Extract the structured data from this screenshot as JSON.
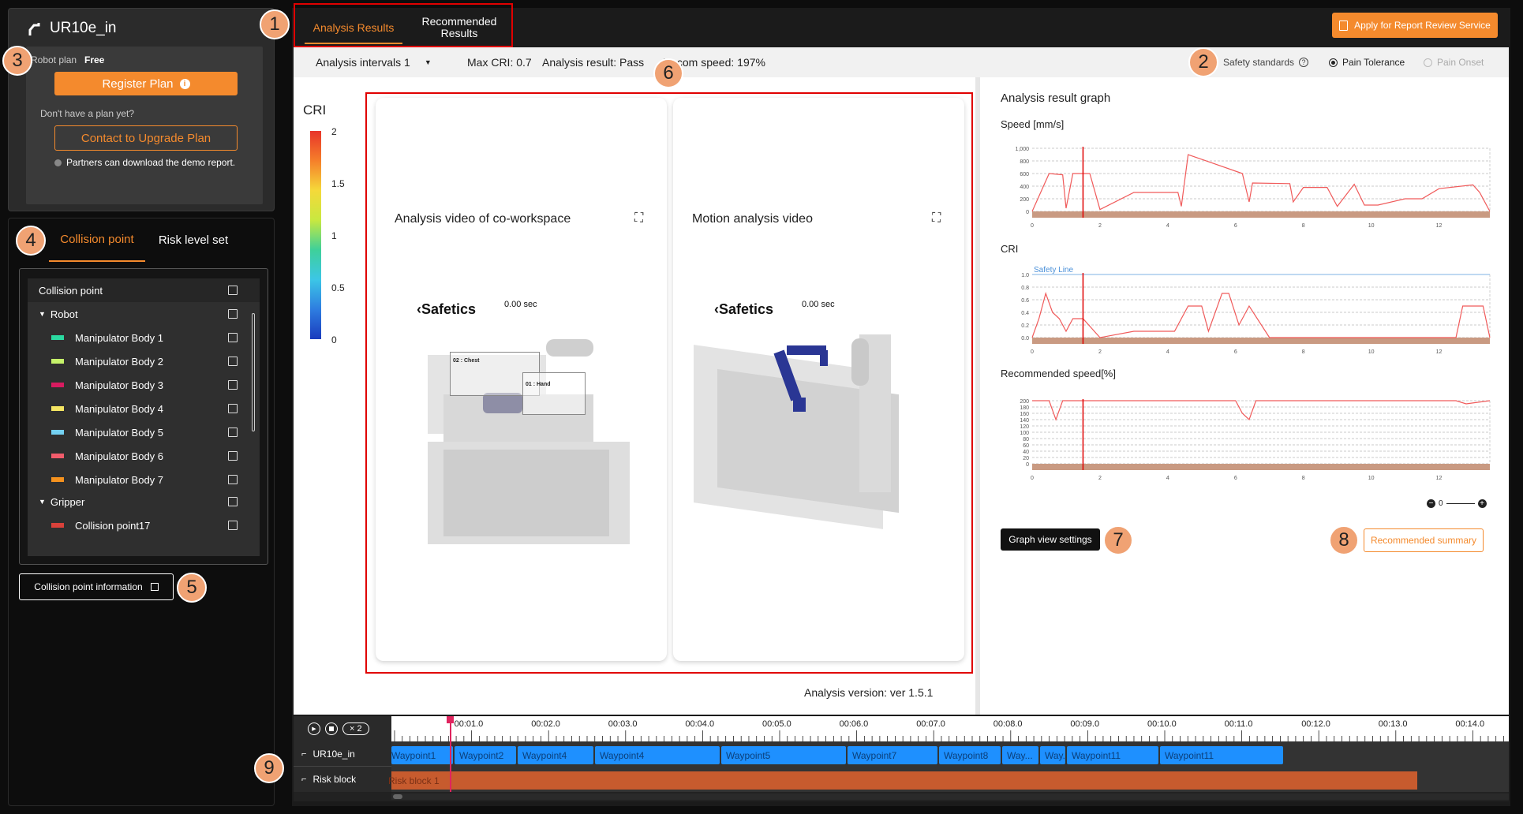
{
  "robot": {
    "name": "UR10e_in",
    "plan_label": "Robot plan",
    "plan_value": "Free"
  },
  "plan": {
    "register_label": "Register Plan",
    "no_plan_text": "Don't have a plan yet?",
    "upgrade_label": "Contact to Upgrade Plan",
    "demo_note": "Partners can download the demo report."
  },
  "left_tabs": {
    "collision": "Collision point",
    "risk": "Risk level set"
  },
  "tree": {
    "header": "Collision point",
    "robot_group": "Robot",
    "items": [
      {
        "label": "Manipulator Body 1",
        "color": "#2bd9a0"
      },
      {
        "label": "Manipulator Body 2",
        "color": "#c6f26a"
      },
      {
        "label": "Manipulator Body 3",
        "color": "#d81b60"
      },
      {
        "label": "Manipulator Body 4",
        "color": "#f5e663"
      },
      {
        "label": "Manipulator Body 5",
        "color": "#74d1f2"
      },
      {
        "label": "Manipulator Body 6",
        "color": "#f25c6b"
      },
      {
        "label": "Manipulator Body 7",
        "color": "#f5921e"
      }
    ],
    "gripper_group": "Gripper",
    "gripper_items": [
      {
        "label": "Collision point17",
        "color": "#d9413a"
      }
    ]
  },
  "collision_info_button": "Collision point information",
  "badges": [
    "1",
    "2",
    "3",
    "4",
    "5",
    "6",
    "7",
    "8",
    "9"
  ],
  "main_tabs": {
    "analysis": "Analysis Results",
    "recommended_line1": "Recommended",
    "recommended_line2": "Results"
  },
  "apply_button": "Apply for Report Review Service",
  "infobar": {
    "interval": "Analysis intervals 1",
    "max_cri": "Max CRI: 0.7",
    "result": "Analysis result: Pass",
    "recom_speed": "Recom speed: 197%",
    "safety_label": "Safety standards",
    "pain_tolerance": "Pain Tolerance",
    "pain_onset": "Pain Onset"
  },
  "cri_legend": {
    "title": "CRI",
    "ticks": [
      "2",
      "1.5",
      "1",
      "0.5",
      "0"
    ]
  },
  "video1": {
    "title": "Analysis video of co-workspace",
    "brand": "Safetics",
    "time": "0.00 sec",
    "label_chest": "02 : Chest",
    "label_hand": "01 : Hand"
  },
  "video2": {
    "title": "Motion analysis video",
    "brand": "Safetics",
    "time": "0.00 sec"
  },
  "version": "Analysis version: ver 1.5.1",
  "graph_panel": {
    "title": "Analysis result graph",
    "speed_title": "Speed [mm/s]",
    "cri_title": "CRI",
    "safety_line": "Safety Line",
    "recspeed_title": "Recommended speed[%]",
    "speed_ticks": [
      "1,000",
      "800",
      "600",
      "400",
      "200",
      "0"
    ],
    "cri_ticks": [
      "1.0",
      "0.8",
      "0.6",
      "0.4",
      "0.2",
      "0.0"
    ],
    "rec_ticks": [
      "200",
      "180",
      "160",
      "140",
      "120",
      "100",
      "80",
      "60",
      "40",
      "20",
      "0"
    ],
    "x_ticks": [
      "0",
      "2",
      "4",
      "6",
      "8",
      "10",
      "12"
    ],
    "zoom_value": "0",
    "graph_settings": "Graph view settings",
    "recommended_summary": "Recommended summary"
  },
  "chart_data": [
    {
      "type": "line",
      "title": "Speed [mm/s]",
      "ylim": [
        0,
        1000
      ],
      "xlim": [
        0,
        13.5
      ],
      "x": [
        0,
        0.5,
        0.9,
        1.0,
        1.2,
        1.7,
        2.0,
        3.0,
        4.3,
        4.4,
        4.6,
        6.2,
        6.4,
        6.5,
        7.6,
        7.7,
        8.0,
        8.7,
        9.0,
        9.5,
        9.8,
        10.2,
        11.0,
        11.5,
        12.0,
        13.0,
        13.2,
        13.5
      ],
      "values": [
        0,
        600,
        580,
        50,
        600,
        600,
        30,
        300,
        300,
        80,
        900,
        600,
        150,
        450,
        440,
        150,
        380,
        380,
        80,
        430,
        100,
        100,
        200,
        200,
        360,
        420,
        300,
        0
      ]
    },
    {
      "type": "line",
      "title": "CRI",
      "ylim": [
        0,
        1.0
      ],
      "xlim": [
        0,
        13.5
      ],
      "x": [
        0,
        0.2,
        0.4,
        0.6,
        0.8,
        1.0,
        1.2,
        1.5,
        2.0,
        3.0,
        4.2,
        4.6,
        5.0,
        5.2,
        5.6,
        5.8,
        6.1,
        6.4,
        7.0,
        12.5,
        12.7,
        13.3,
        13.5
      ],
      "values": [
        0,
        0.3,
        0.7,
        0.4,
        0.3,
        0.1,
        0.3,
        0.3,
        0,
        0.1,
        0.1,
        0.5,
        0.5,
        0.1,
        0.7,
        0.7,
        0.2,
        0.5,
        0,
        0,
        0.5,
        0.5,
        0
      ],
      "annotations": [
        "Safety Line"
      ]
    },
    {
      "type": "line",
      "title": "Recommended speed[%]",
      "ylim": [
        0,
        200
      ],
      "xlim": [
        0,
        13.5
      ],
      "x": [
        0,
        0.5,
        0.7,
        0.9,
        6.0,
        6.2,
        6.4,
        6.6,
        12.5,
        12.8,
        13.5
      ],
      "values": [
        200,
        200,
        140,
        200,
        200,
        160,
        140,
        200,
        200,
        190,
        200
      ]
    }
  ],
  "timeline": {
    "controls_speed": "× 2",
    "ticks": [
      "00:01.0",
      "00:02.0",
      "00:03.0",
      "00:04.0",
      "00:05.0",
      "00:06.0",
      "00:07.0",
      "00:08.0",
      "00:09.0",
      "00:10.0",
      "00:11.0",
      "00:12.0",
      "00:13.0",
      "00:14.0"
    ],
    "track_robot": "UR10e_in",
    "track_risk": "Risk block",
    "waypoints": [
      "Waypoint1",
      "Waypoint2",
      "Waypoint4",
      "Waypoint4",
      "Waypoint5",
      "Waypoint7",
      "Waypoint8",
      "Way...",
      "Way...",
      "Waypoint11",
      "Waypoint11"
    ],
    "risk_block": "Risk block 1"
  },
  "colors": {
    "accent": "#f48a2d",
    "highlight_red": "#e00000",
    "waypoint_blue": "#1e90ff",
    "risk_orange": "#c75b2e"
  }
}
